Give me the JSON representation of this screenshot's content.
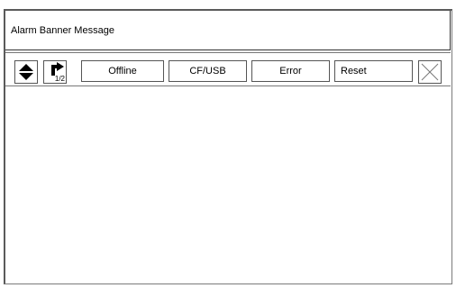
{
  "banner": {
    "message": "Alarm Banner Message"
  },
  "toolbar": {
    "scroll_icon": "up-down-arrow-icon",
    "page_icon": "right-arrow-icon",
    "page_indicator": "1/2",
    "buttons": [
      {
        "label": "Offline"
      },
      {
        "label": "CF/USB"
      },
      {
        "label": "Error"
      },
      {
        "label": "Reset"
      }
    ],
    "close_icon": "close-icon"
  },
  "colors": {
    "border": "#555555",
    "background": "#ffffff"
  }
}
